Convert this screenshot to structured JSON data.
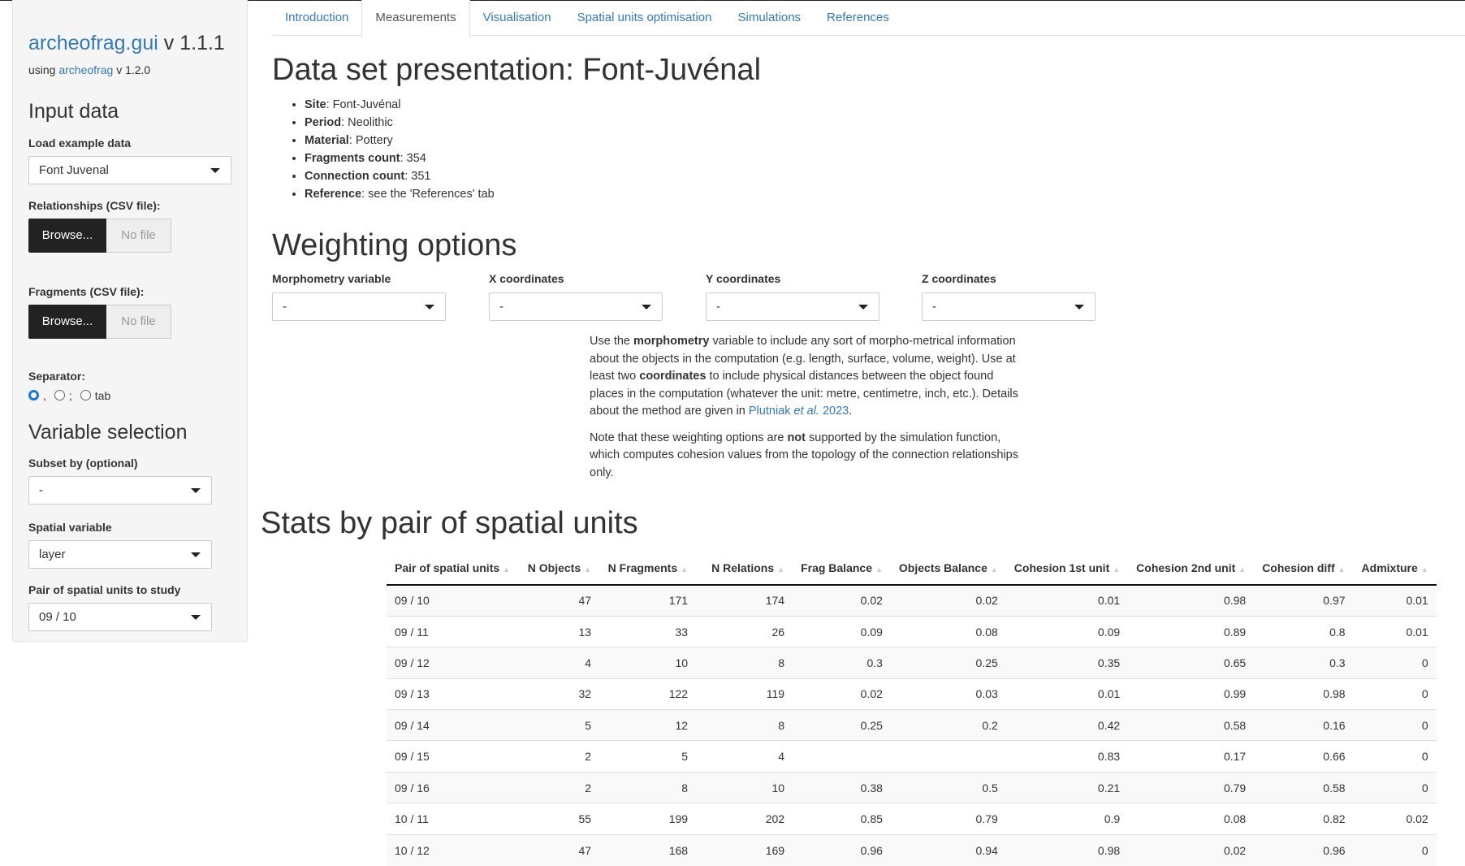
{
  "app": {
    "name": "archeofrag.gui",
    "version": "v 1.1.1",
    "using_prefix": "using",
    "using_link": "archeofrag",
    "using_version": "v 1.2.0"
  },
  "sidebar": {
    "input_heading": "Input data",
    "load_example_label": "Load example data",
    "load_example_value": "Font Juvenal",
    "relationships_label": "Relationships (CSV file):",
    "fragments_label": "Fragments (CSV file):",
    "browse_label": "Browse...",
    "no_file_label": "No file",
    "separator_label": "Separator:",
    "separator_options": [
      ",",
      ";",
      "tab"
    ],
    "separator_selected": ",",
    "variable_heading": "Variable selection",
    "subset_label": "Subset by (optional)",
    "subset_value": "-",
    "spatial_label": "Spatial variable",
    "spatial_value": "layer",
    "pair_label": "Pair of spatial units to study",
    "pair_value": "09 / 10"
  },
  "tabs": [
    {
      "label": "Introduction",
      "active": false
    },
    {
      "label": "Measurements",
      "active": true
    },
    {
      "label": "Visualisation",
      "active": false
    },
    {
      "label": "Spatial units optimisation",
      "active": false
    },
    {
      "label": "Simulations",
      "active": false
    },
    {
      "label": "References",
      "active": false
    }
  ],
  "dataset": {
    "heading": "Data set presentation: Font-Juvénal",
    "items": [
      {
        "key": "Site",
        "value": ": Font-Juvénal"
      },
      {
        "key": "Period",
        "value": ": Neolithic"
      },
      {
        "key": "Material",
        "value": ": Pottery"
      },
      {
        "key": "Fragments count",
        "value": ": 354"
      },
      {
        "key": "Connection count",
        "value": ": 351"
      },
      {
        "key": "Reference",
        "value": ": see the 'References' tab"
      }
    ]
  },
  "weighting": {
    "heading": "Weighting options",
    "selects": [
      {
        "label": "Morphometry variable",
        "value": "-"
      },
      {
        "label": "X coordinates",
        "value": "-"
      },
      {
        "label": "Y coordinates",
        "value": "-"
      },
      {
        "label": "Z coordinates",
        "value": "-"
      }
    ],
    "p1_a": "Use the ",
    "p1_b": "morphometry",
    "p1_c": " variable to include any sort of morpho-metrical information about the objects in the computation (e.g. length, surface, volume, weight). Use at least two ",
    "p1_d": "coordinates",
    "p1_e": " to include physical distances between the object found places in the computation (whatever the unit: metre, centimetre, inch, etc.). Details about the method are given in ",
    "p1_link1": "Plutniak ",
    "p1_link2": "et al.",
    "p1_link3": " 2023",
    "p1_f": ".",
    "p2_a": "Note that these weighting options are ",
    "p2_b": "not",
    "p2_c": " supported by the simulation function, which computes cohesion values from the topology of the connection relationships only."
  },
  "stats": {
    "heading": "Stats by pair of spatial units",
    "columns": [
      "Pair of spatial units",
      "N Objects",
      "N Fragments",
      "N Relations",
      "Frag Balance",
      "Objects Balance",
      "Cohesion 1st unit",
      "Cohesion 2nd unit",
      "Cohesion diff",
      "Admixture"
    ],
    "rows": [
      [
        "09 / 10",
        "47",
        "171",
        "174",
        "0.02",
        "0.02",
        "0.01",
        "0.98",
        "0.97",
        "0.01"
      ],
      [
        "09 / 11",
        "13",
        "33",
        "26",
        "0.09",
        "0.08",
        "0.09",
        "0.89",
        "0.8",
        "0.01"
      ],
      [
        "09 / 12",
        "4",
        "10",
        "8",
        "0.3",
        "0.25",
        "0.35",
        "0.65",
        "0.3",
        "0"
      ],
      [
        "09 / 13",
        "32",
        "122",
        "119",
        "0.02",
        "0.03",
        "0.01",
        "0.99",
        "0.98",
        "0"
      ],
      [
        "09 / 14",
        "5",
        "12",
        "8",
        "0.25",
        "0.2",
        "0.42",
        "0.58",
        "0.16",
        "0"
      ],
      [
        "09 / 15",
        "2",
        "5",
        "4",
        "",
        "",
        "0.83",
        "0.17",
        "0.66",
        "0"
      ],
      [
        "09 / 16",
        "2",
        "8",
        "10",
        "0.38",
        "0.5",
        "0.21",
        "0.79",
        "0.58",
        "0"
      ],
      [
        "10 / 11",
        "55",
        "199",
        "202",
        "0.85",
        "0.79",
        "0.9",
        "0.08",
        "0.82",
        "0.02"
      ],
      [
        "10 / 12",
        "47",
        "168",
        "169",
        "0.96",
        "0.94",
        "0.98",
        "0.02",
        "0.96",
        "0"
      ]
    ]
  }
}
